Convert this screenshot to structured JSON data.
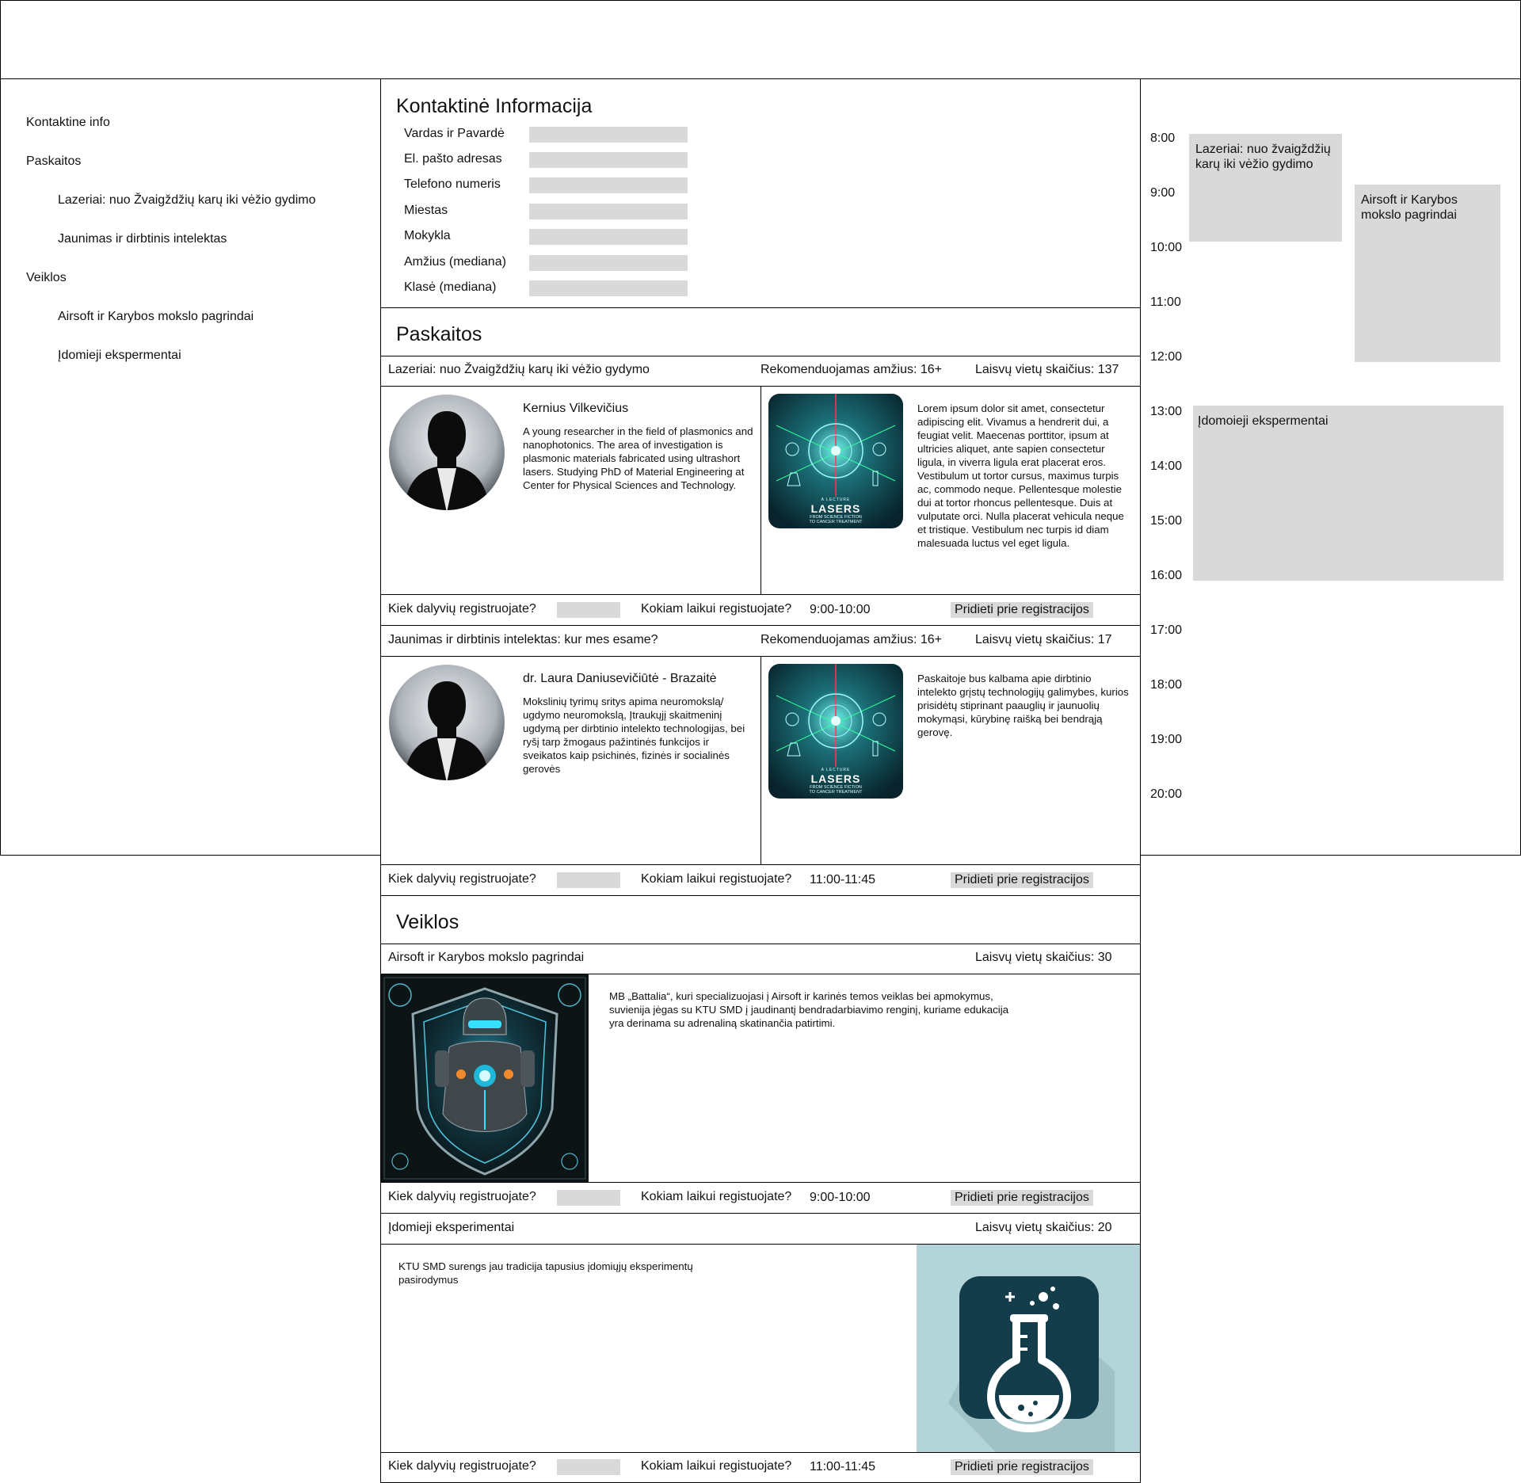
{
  "sidebar": {
    "items": [
      {
        "label": "Kontaktine info"
      },
      {
        "label": "Paskaitos"
      },
      {
        "label": "Lazeriai: nuo Žvaigždžių karų iki vėžio gydimo"
      },
      {
        "label": "Jaunimas ir dirbtinis intelektas"
      },
      {
        "label": "Veiklos"
      },
      {
        "label": "Airsoft ir Karybos mokslo pagrindai"
      },
      {
        "label": "Įdomieji ekspermentai"
      }
    ]
  },
  "contact": {
    "title": "Kontaktinė Informacija",
    "fields": [
      {
        "label": "Vardas ir Pavardė",
        "value": ""
      },
      {
        "label": "El. pašto adresas",
        "value": ""
      },
      {
        "label": "Telefono numeris",
        "value": ""
      },
      {
        "label": "Miestas",
        "value": ""
      },
      {
        "label": "Mokykla",
        "value": ""
      },
      {
        "label": "Amžius (mediana)",
        "value": ""
      },
      {
        "label": "Klasė (mediana)",
        "value": ""
      }
    ]
  },
  "lectures": {
    "title": "Paskaitos",
    "items": [
      {
        "title": "Lazeriai: nuo Žvaigždžių karų iki vėžio gydymo",
        "age": "Rekomenduojamas amžius: 16+",
        "seats": "Laisvų vietų skaičius: 137",
        "speaker_name": "Kernius Vilkevičius",
        "speaker_bio": "A young researcher in the field of plasmonics and nanophotonics. The area of investigation is plasmonic materials fabricated using ultrashort lasers. Studying PhD of Material Engineering at Center for Physical Sciences and Technology.",
        "poster_small": "A LECTURE",
        "poster_title": "LASERS",
        "poster_sub": "FROM SCIENCE FICTION\nTO CANCER TREATMENT",
        "description": "Lorem ipsum dolor sit amet, consectetur adipiscing elit. Vivamus a hendrerit dui, a feugiat velit. Maecenas porttitor, ipsum at ultricies aliquet, ante sapien consectetur ligula, in viverra ligula erat placerat eros. Vestibulum ut tortor cursus, maximus turpis ac, commodo neque. Pellentesque molestie dui at tortor rhoncus pellentesque. Duis at vulputate orci. Nulla placerat vehicula neque et tristique. Vestibulum nec turpis id diam malesuada luctus vel eget ligula.",
        "count_label": "Kiek dalyvių registruojate?",
        "time_label": "Kokiam laikui registuojate?",
        "time_value": "9:00-10:00",
        "add_label": "Pridieti prie registracijos"
      },
      {
        "title": "Jaunimas ir dirbtinis intelektas: kur mes esame?",
        "age": "Rekomenduojamas amžius: 16+",
        "seats": "Laisvų vietų skaičius: 17",
        "speaker_name": "dr. Laura Daniusevičiūtė - Brazaitė",
        "speaker_bio": "Mokslinių tyrimų sritys apima neuromokslą/ ugdymo neuromokslą, Įtraukųjį skaitmeninį ugdymą per dirbtinio intelekto technologijas, bei ryšį tarp žmogaus pažintinės funkcijos ir sveikatos kaip psichinės, fizinės ir socialinės gerovės",
        "poster_small": "A LECTURE",
        "poster_title": "LASERS",
        "poster_sub": "FROM SCIENCE FICTION\nTO CANCER TREATMENT",
        "description": "Paskaitoje bus kalbama apie dirbtinio intelekto grįstų technologijų galimybes, kurios prisidėtų stiprinant paauglių ir jaunuolių mokymąsi, kūrybinę raišką bei bendrąją gerovę.",
        "count_label": "Kiek dalyvių registruojate?",
        "time_label": "Kokiam laikui registuojate?",
        "time_value": "11:00-11:45",
        "add_label": "Pridieti prie registracijos"
      }
    ]
  },
  "activities": {
    "title": "Veiklos",
    "items": [
      {
        "title": "Airsoft ir Karybos mokslo pagrindai",
        "seats": "Laisvų vietų skaičius: 30",
        "description": "MB „Battalia“, kuri specializuojasi į Airsoft ir karinės temos veiklas bei apmokymus, suvienija jėgas su KTU SMD į jaudinantį bendradarbiavimo renginį, kuriame edukacija yra derinama su adrenaliną skatinančia patirtimi.",
        "count_label": "Kiek dalyvių registruojate?",
        "time_label": "Kokiam laikui registuojate?",
        "time_value": "9:00-10:00",
        "add_label": "Pridieti prie registracijos"
      },
      {
        "title": "Įdomieji eksperimentai",
        "seats": "Laisvų vietų skaičius: 20",
        "description": "KTU SMD surengs jau tradicija tapusius įdomiųjų eksperimentų pasirodymus",
        "count_label": "Kiek dalyvių registruojate?",
        "time_label": "Kokiam laikui registuojate?",
        "time_value": "11:00-11:45",
        "add_label": "Pridieti prie registracijos"
      }
    ]
  },
  "schedule": {
    "times": [
      "8:00",
      "9:00",
      "10:00",
      "11:00",
      "12:00",
      "13:00",
      "14:00",
      "15:00",
      "16:00",
      "17:00",
      "18:00",
      "19:00",
      "20:00"
    ],
    "events": [
      {
        "label": "Lazeriai: nuo žvaigždžių karų iki vėžio gydimo"
      },
      {
        "label": "Airsoft ir Karybos mokslo pagrindai"
      },
      {
        "label": "Įdomoieji ekspermentai"
      }
    ]
  },
  "colors": {
    "placeholder_gray": "#d9d9d9",
    "border": "#000000",
    "poster_teal": "#0d3a44",
    "flask_tile": "#133d4a",
    "flask_bg": "#b3d4d8"
  }
}
